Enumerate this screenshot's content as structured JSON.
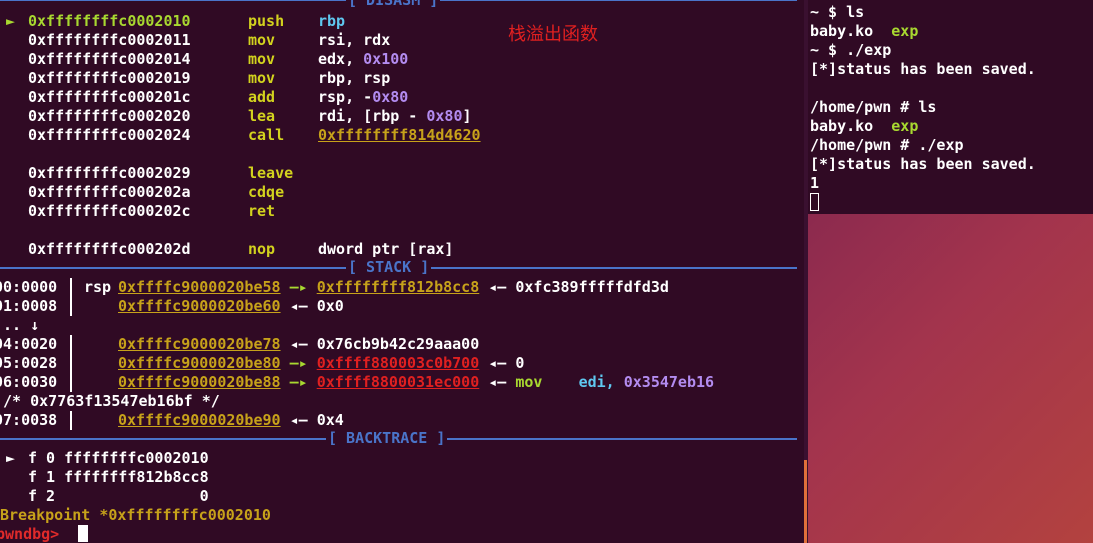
{
  "disasm": {
    "title": "[ DISASM ]",
    "rows": [
      {
        "marker": "►",
        "addr": "0xffffffffc0002010",
        "mnem": "push",
        "ops": [
          {
            "t": "rbp",
            "c": "cyan"
          }
        ],
        "current": true
      },
      {
        "marker": "",
        "addr": "0xffffffffc0002011",
        "mnem": "mov",
        "ops": [
          {
            "t": "rsi, rdx",
            "c": "white"
          }
        ]
      },
      {
        "marker": "",
        "addr": "0xffffffffc0002014",
        "mnem": "mov",
        "ops": [
          {
            "t": "edx, ",
            "c": "white"
          },
          {
            "t": "0x100",
            "c": "purple"
          }
        ]
      },
      {
        "marker": "",
        "addr": "0xffffffffc0002019",
        "mnem": "mov",
        "ops": [
          {
            "t": "rbp, rsp",
            "c": "white"
          }
        ]
      },
      {
        "marker": "",
        "addr": "0xffffffffc000201c",
        "mnem": "add",
        "ops": [
          {
            "t": "rsp, -",
            "c": "white"
          },
          {
            "t": "0x80",
            "c": "purple"
          }
        ]
      },
      {
        "marker": "",
        "addr": "0xffffffffc0002020",
        "mnem": "lea",
        "ops": [
          {
            "t": "rdi, [rbp - ",
            "c": "white"
          },
          {
            "t": "0x80",
            "c": "purple"
          },
          {
            "t": "]",
            "c": "white"
          }
        ]
      },
      {
        "marker": "",
        "addr": "0xffffffffc0002024",
        "mnem": "call",
        "ops": [
          {
            "t": "0xffffffff814d4620",
            "c": "gold"
          }
        ]
      },
      {
        "blank": true
      },
      {
        "marker": "",
        "addr": "0xffffffffc0002029",
        "mnem": "leave",
        "ops": []
      },
      {
        "marker": "",
        "addr": "0xffffffffc000202a",
        "mnem": "cdqe",
        "ops": []
      },
      {
        "marker": "",
        "addr": "0xffffffffc000202c",
        "mnem": "ret",
        "ops": []
      },
      {
        "blank": true
      },
      {
        "marker": "",
        "addr": "0xffffffffc000202d",
        "mnem": "nop",
        "ops": [
          {
            "t": "dword ptr [rax]",
            "c": "white"
          }
        ]
      }
    ]
  },
  "annotation": "栈溢出函数",
  "stack": {
    "title": "[ STACK ]",
    "rows": [
      {
        "idx": "00:0000",
        "reg": "rsp",
        "parts": [
          {
            "t": "0xffffc9000020be58",
            "c": "gold"
          },
          {
            "t": " —▸ ",
            "c": "arrow"
          },
          {
            "t": "0xffffffff812b8cc8",
            "c": "gold"
          },
          {
            "t": " ◂— ",
            "c": "white"
          },
          {
            "t": "0xfc389fffffdfd3d",
            "c": "white"
          }
        ]
      },
      {
        "idx": "01:0008",
        "reg": "",
        "parts": [
          {
            "t": "0xffffc9000020be60",
            "c": "gold"
          },
          {
            "t": " ◂— ",
            "c": "white"
          },
          {
            "t": "0x0",
            "c": "white"
          }
        ]
      },
      {
        "idx": "... ↓",
        "reg": "",
        "nobar": true,
        "parts": []
      },
      {
        "idx": "04:0020",
        "reg": "",
        "parts": [
          {
            "t": "0xffffc9000020be78",
            "c": "gold"
          },
          {
            "t": " ◂— ",
            "c": "white"
          },
          {
            "t": "0x76cb9b42c29aaa00",
            "c": "white"
          }
        ]
      },
      {
        "idx": "05:0028",
        "reg": "",
        "parts": [
          {
            "t": "0xffffc9000020be80",
            "c": "gold"
          },
          {
            "t": " —▸ ",
            "c": "arrow"
          },
          {
            "t": "0xffff880003c0b700",
            "c": "red"
          },
          {
            "t": " ◂— ",
            "c": "white"
          },
          {
            "t": "0",
            "c": "white"
          }
        ]
      },
      {
        "idx": "06:0030",
        "reg": "",
        "parts": [
          {
            "t": "0xffffc9000020be88",
            "c": "gold"
          },
          {
            "t": " —▸ ",
            "c": "arrow"
          },
          {
            "t": "0xffff8800031ec000",
            "c": "red"
          },
          {
            "t": " ◂— ",
            "c": "white"
          },
          {
            "t": "mov",
            "c": "green"
          },
          {
            "t": "    edi, ",
            "c": "cyan"
          },
          {
            "t": "0x3547eb16",
            "c": "purple"
          }
        ]
      },
      {
        "idx": " /* 0x7763f13547eb16bf */",
        "reg": "",
        "nobar": true,
        "parts": []
      },
      {
        "idx": "07:0038",
        "reg": "",
        "parts": [
          {
            "t": "0xffffc9000020be90",
            "c": "gold"
          },
          {
            "t": " ◂— ",
            "c": "white"
          },
          {
            "t": "0x4",
            "c": "white"
          }
        ]
      }
    ]
  },
  "backtrace": {
    "title": "[ BACKTRACE ]",
    "rows": [
      {
        "marker": "►",
        "text": "f 0 ffffffffc0002010"
      },
      {
        "marker": "",
        "text": "f 1 ffffffff812b8cc8"
      },
      {
        "marker": "",
        "text": "f 2                0"
      }
    ]
  },
  "breakpoint": "Breakpoint *0xffffffffc0002010",
  "prompt": "pwndbg>",
  "right_terminal": [
    [
      {
        "t": "~ $ ls",
        "c": "white"
      }
    ],
    [
      {
        "t": "baby.ko  ",
        "c": "white"
      },
      {
        "t": "exp",
        "c": "exp"
      }
    ],
    [
      {
        "t": "~ $ ./exp",
        "c": "white"
      }
    ],
    [
      {
        "t": "[*]status has been saved.",
        "c": "white"
      }
    ],
    [],
    [
      {
        "t": "/home/pwn # ls",
        "c": "white"
      }
    ],
    [
      {
        "t": "baby.ko  ",
        "c": "white"
      },
      {
        "t": "exp",
        "c": "exp"
      }
    ],
    [
      {
        "t": "/home/pwn # ./exp",
        "c": "white"
      }
    ],
    [
      {
        "t": "[*]status has been saved.",
        "c": "white"
      }
    ],
    [
      {
        "t": "1",
        "c": "white"
      }
    ]
  ]
}
